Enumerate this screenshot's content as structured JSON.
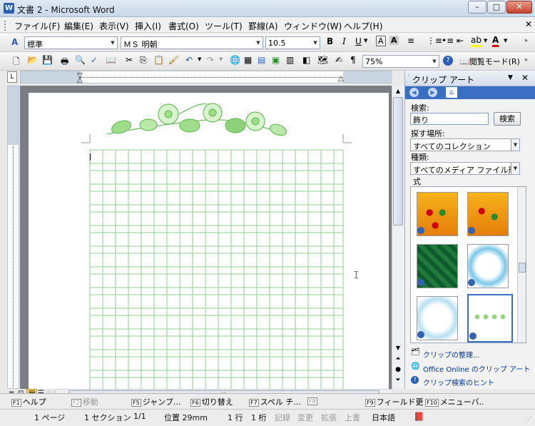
{
  "window": {
    "title": "文書 2 - Microsoft Word"
  },
  "menu": [
    "ファイル(F)",
    "編集(E)",
    "表示(V)",
    "挿入(I)",
    "書式(O)",
    "ツール(T)",
    "罫線(A)",
    "ウィンドウ(W)",
    "ヘルプ(H)"
  ],
  "formatting": {
    "style": "標準",
    "font": "ＭＳ 明朝",
    "size": "10.5"
  },
  "standard": {
    "zoom": "75%",
    "reading_mode": "閲覧モード(R)"
  },
  "taskpane": {
    "title": "クリップ アート",
    "search_label": "検索:",
    "search_value": "飾り",
    "search_button": "検索",
    "location_label": "探す場所:",
    "location_value": "すべてのコレクション",
    "type_label": "種類:",
    "type_value": "すべてのメディア ファイル形式",
    "links": [
      "クリップの整理...",
      "Office Online のクリップ アート",
      "クリップ検索のヒント"
    ]
  },
  "fnbar": [
    {
      "key": "F1",
      "label": "ヘルプ",
      "dim": false
    },
    {
      "key": "F2",
      "label": "移動",
      "dim": true
    },
    {
      "key": "F5",
      "label": "ジャンプ...",
      "dim": false
    },
    {
      "key": "F6",
      "label": "切り替え",
      "dim": false
    },
    {
      "key": "F7",
      "label": "スペル チ...",
      "dim": false
    },
    {
      "key": "F8",
      "label": "",
      "dim": true
    },
    {
      "key": "F9",
      "label": "フィールド更",
      "dim": false
    },
    {
      "key": "F10",
      "label": "メニューバ..",
      "dim": false
    }
  ],
  "status": {
    "page": "1 ページ",
    "section": "1 セクション",
    "pages": "1/1",
    "position": "位置 29mm",
    "line": "1 行",
    "column": "1 桁",
    "rec": "記録",
    "trk": "変更",
    "ext": "拡張",
    "ovr": "上書",
    "lang": "日本語"
  },
  "colors": {
    "grid": "#8fd18f",
    "accent": "#2b5fb4"
  }
}
